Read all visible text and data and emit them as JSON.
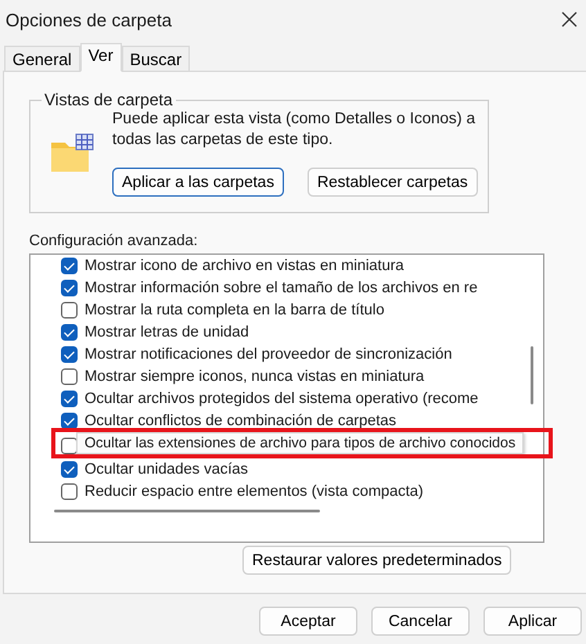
{
  "window": {
    "title": "Opciones de carpeta"
  },
  "tabs": [
    {
      "label": "General",
      "selected": false
    },
    {
      "label": "Ver",
      "selected": true
    },
    {
      "label": "Buscar",
      "selected": false
    }
  ],
  "folder_views": {
    "title": "Vistas de carpeta",
    "description": "Puede aplicar esta vista (como Detalles o Iconos) a todas las carpetas de este tipo.",
    "buttons": [
      "Aplicar a las carpetas",
      "Restablecer carpetas"
    ]
  },
  "advanced": {
    "label": "Configuración avanzada:",
    "items": [
      {
        "label": "Mostrar icono de archivo en vistas en miniatura",
        "checked": true
      },
      {
        "label": "Mostrar información sobre el tamaño de los archivos en re",
        "checked": true
      },
      {
        "label": "Mostrar la ruta completa en la barra de título",
        "checked": false
      },
      {
        "label": "Mostrar letras de unidad",
        "checked": true
      },
      {
        "label": "Mostrar notificaciones del proveedor de sincronización",
        "checked": true
      },
      {
        "label": "Mostrar siempre iconos, nunca vistas en miniatura",
        "checked": false
      },
      {
        "label": "Ocultar archivos protegidos del sistema operativo (recome",
        "checked": true
      },
      {
        "label": "Ocultar conflictos de combinación de carpetas",
        "checked": true
      },
      {
        "checked": false
      },
      {
        "label": "Ocultar unidades vacías",
        "checked": true
      },
      {
        "label": "Reducir espacio entre elementos (vista compacta)",
        "checked": false
      }
    ],
    "tooltip": "Ocultar las extensiones de archivo para tipos de archivo conocidos",
    "restore_button": "Restaurar valores predeterminados"
  },
  "buttons": [
    "Aceptar",
    "Cancelar",
    "Aplicar"
  ]
}
